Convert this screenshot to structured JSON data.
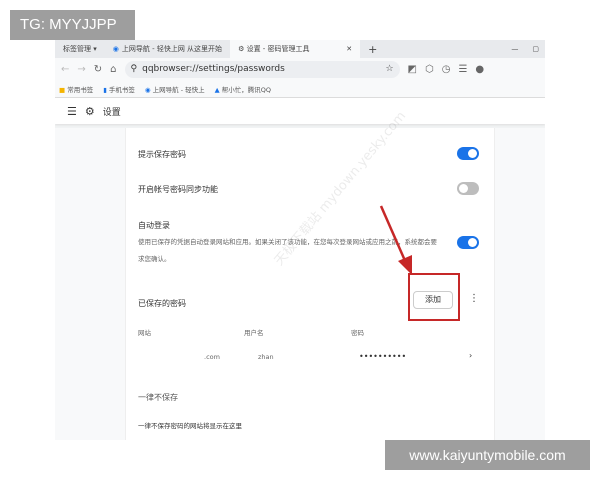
{
  "overlay": {
    "tg": "TG: MYYJJPP",
    "site": "www.kaiyuntymobile.com"
  },
  "tabs": [
    {
      "label": "标签管理 ▾"
    },
    {
      "label": "上网导航 - 轻快上网 从这里开始"
    },
    {
      "label": "设置 - 密码管理工具",
      "active": true
    }
  ],
  "address": {
    "url": "qqbrowser://settings/passwords"
  },
  "bookmarks": [
    "常用书签",
    "手机书签",
    "上网导航 - 轻快上",
    "帮小忙，腾讯QQ"
  ],
  "header": {
    "title": "设置"
  },
  "settings": [
    {
      "label": "提示保存密码",
      "enabled": true
    },
    {
      "label": "开启帐号密码同步功能",
      "enabled": false
    },
    {
      "label": "自动登录",
      "desc": "使用已保存的凭据自动登录网站和应用。如果关闭了该功能，在您每次登录网站或应用之前，系统都会要求您确认。",
      "enabled": true
    }
  ],
  "saved": {
    "title": "已保存的密码",
    "add_label": "添加",
    "columns": [
      "网站",
      "用户名",
      "密码"
    ],
    "rows": [
      {
        "site": ".com",
        "user": "zhan",
        "password": "••••••••••"
      }
    ]
  },
  "never": {
    "title": "一律不保存",
    "empty": "一律不保存密码的网站将显示在这里"
  },
  "watermark": "天极下载站 mydown.yesky.com",
  "colors": {
    "accent": "#1a73e8",
    "highlight": "#c62828"
  }
}
